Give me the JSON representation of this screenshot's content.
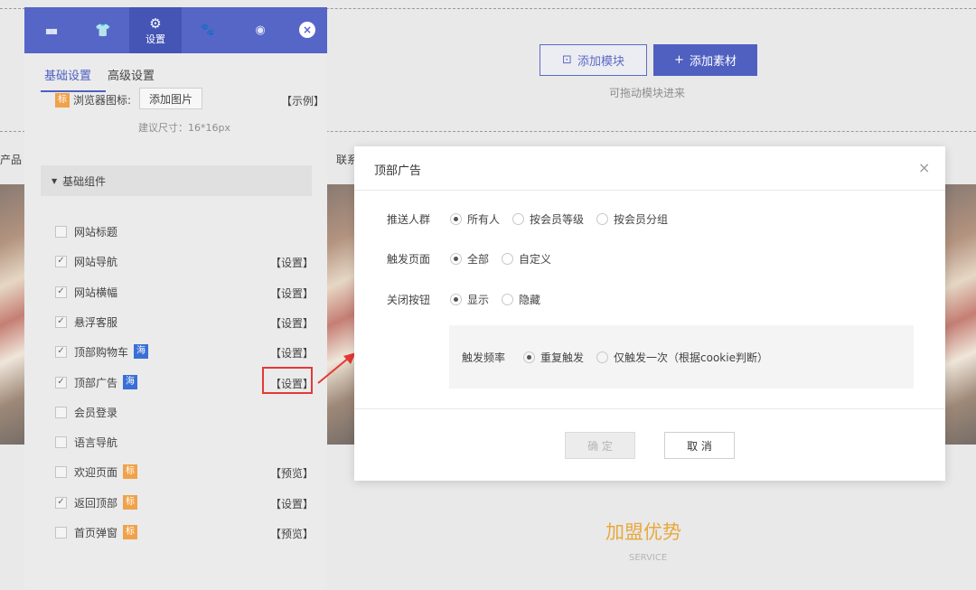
{
  "canvas": {
    "add_module_label": "添加模块",
    "add_material_label": "添加素材",
    "drag_hint": "可拖动模块进来",
    "nav_left": "产品",
    "nav_mid": "联系",
    "section_title": "加盟优势",
    "section_subtitle": "SERVICE"
  },
  "panel": {
    "toolbar": [
      {
        "icon": "grid-icon",
        "glyph": "▪▪",
        "label": ""
      },
      {
        "icon": "shirt-icon",
        "glyph": "👕",
        "label": ""
      },
      {
        "icon": "gear-icon",
        "glyph": "⚙",
        "label": "设置"
      },
      {
        "icon": "paw-icon",
        "glyph": "🐾",
        "label": ""
      },
      {
        "icon": "globe-icon",
        "glyph": "◉",
        "label": ""
      }
    ],
    "close_glyph": "×",
    "tabs": {
      "basic": "基础设置",
      "advanced": "高级设置"
    },
    "browser_icon": {
      "badge": "标",
      "label": "浏览器图标:",
      "button": "添加图片",
      "example": "【示例】",
      "hint": "建议尺寸：16*16px"
    },
    "group_title": "基础组件",
    "components": [
      {
        "label": "网站标题",
        "checked": false,
        "badge": "",
        "action": ""
      },
      {
        "label": "网站导航",
        "checked": true,
        "badge": "",
        "action": "【设置】"
      },
      {
        "label": "网站横幅",
        "checked": true,
        "badge": "",
        "action": "【设置】"
      },
      {
        "label": "悬浮客服",
        "checked": true,
        "badge": "",
        "action": "【设置】"
      },
      {
        "label": "顶部购物车",
        "checked": true,
        "badge": "海",
        "action": "【设置】"
      },
      {
        "label": "顶部广告",
        "checked": true,
        "badge": "海",
        "action": "【设置】"
      },
      {
        "label": "会员登录",
        "checked": false,
        "badge": "",
        "action": ""
      },
      {
        "label": "语言导航",
        "checked": false,
        "badge": "",
        "action": ""
      },
      {
        "label": "欢迎页面",
        "checked": false,
        "badge": "标",
        "action": "【预览】"
      },
      {
        "label": "返回顶部",
        "checked": true,
        "badge": "标",
        "action": "【设置】"
      },
      {
        "label": "首页弹窗",
        "checked": false,
        "badge": "标",
        "action": "【预览】"
      }
    ]
  },
  "modal": {
    "title": "顶部广告",
    "close_glyph": "×",
    "push_audience": {
      "label": "推送人群",
      "options": [
        "所有人",
        "按会员等级",
        "按会员分组"
      ],
      "selected": "所有人"
    },
    "trigger_page": {
      "label": "触发页面",
      "options": [
        "全部",
        "自定义"
      ],
      "selected": "全部"
    },
    "close_button": {
      "label": "关闭按钮",
      "options": [
        "显示",
        "隐藏"
      ],
      "selected": "显示"
    },
    "trigger_freq": {
      "label": "触发频率",
      "options": [
        "重复触发",
        "仅触发一次（根据cookie判断）"
      ],
      "selected": "重复触发"
    },
    "confirm": "确 定",
    "cancel": "取 消"
  },
  "colors": {
    "accent": "#5566c7",
    "highlight": "#e53935",
    "gold": "#e8a93c"
  }
}
